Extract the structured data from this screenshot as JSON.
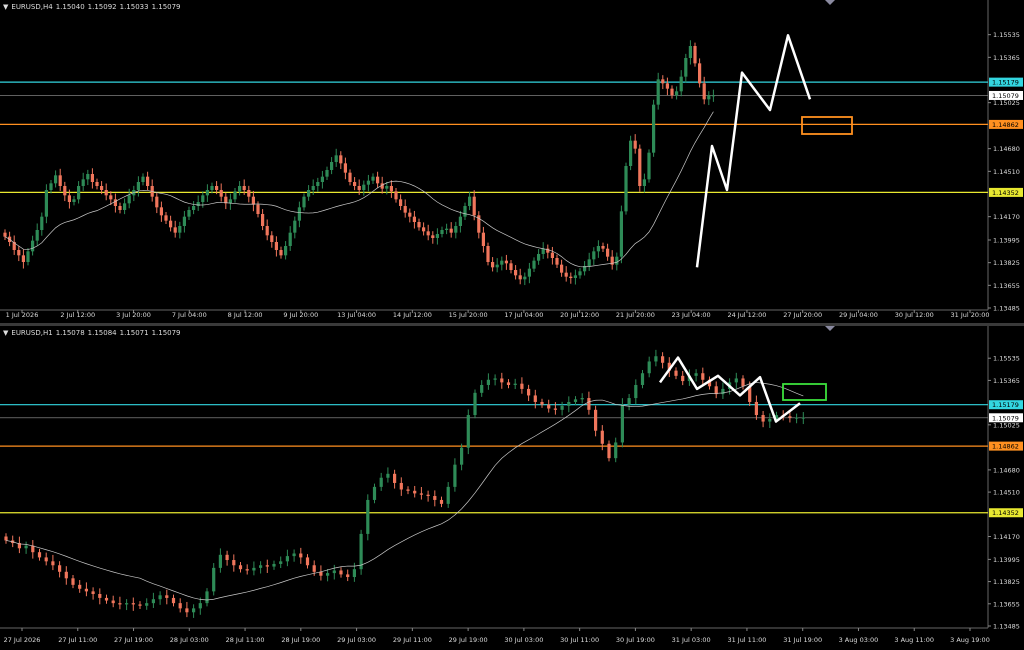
{
  "colors": {
    "bull": "#2e8b57",
    "bear": "#f0765c",
    "wick_bull": "#2e8b57",
    "wick_bear": "#f0765c",
    "ma": "#c8c8c8",
    "cyan": "#33d6e0",
    "orange": "#ff9020",
    "yellow": "#e8e830",
    "price": "#9a9a9a",
    "green_box": "#3ce03c",
    "white_path": "#ffffff"
  },
  "panes": [
    {
      "id": "h4",
      "symbol": "EURUSD,H4",
      "ohlc": [
        "1.15040",
        "1.15092",
        "1.15033",
        "1.15079"
      ],
      "y_range": [
        1.13485,
        1.15705
      ],
      "price_labels": [
        "1.15535",
        "1.15365",
        "1.15025",
        "1.14680",
        "1.14510",
        "1.14170",
        "1.13995",
        "1.13825",
        "1.13655",
        "1.13485"
      ],
      "price_values": [
        1.15535,
        1.15365,
        1.15025,
        1.1468,
        1.1451,
        1.1417,
        1.13995,
        1.13825,
        1.13655,
        1.13485
      ],
      "tags": [
        {
          "label": "1.15179",
          "value": 1.15179,
          "color": "cyan"
        },
        {
          "label": "1.15079",
          "value": 1.15079,
          "color": "price"
        },
        {
          "label": "1.14862",
          "value": 1.14862,
          "color": "orange"
        },
        {
          "label": "1.14352",
          "value": 1.14352,
          "color": "yellow"
        }
      ],
      "time_labels": [
        "1 Jul 2026",
        "2 Jul 12:00",
        "3 Jul 20:00",
        "7 Jul 04:00",
        "8 Jul 12:00",
        "9 Jul 20:00",
        "13 Jul 04:00",
        "14 Jul 12:00",
        "15 Jul 20:00",
        "17 Jul 04:00",
        "20 Jul 12:00",
        "21 Jul 20:00",
        "23 Jul 04:00",
        "24 Jul 12:00",
        "27 Jul 20:00",
        "29 Jul 04:00",
        "30 Jul 12:00",
        "31 Jul 20:00"
      ],
      "candles": [
        1.1402,
        1.1398,
        1.1392,
        1.1388,
        1.1383,
        1.1391,
        1.1399,
        1.1407,
        1.1417,
        1.1437,
        1.1442,
        1.1448,
        1.144,
        1.1433,
        1.1428,
        1.143,
        1.144,
        1.1445,
        1.1449,
        1.1443,
        1.144,
        1.1437,
        1.1433,
        1.143,
        1.1425,
        1.1422,
        1.1427,
        1.1433,
        1.1437,
        1.1443,
        1.1447,
        1.144,
        1.1432,
        1.1424,
        1.1418,
        1.1414,
        1.1409,
        1.1405,
        1.141,
        1.1417,
        1.1422,
        1.1425,
        1.1428,
        1.1433,
        1.1437,
        1.144,
        1.1437,
        1.1432,
        1.1427,
        1.143,
        1.1436,
        1.144,
        1.1437,
        1.1432,
        1.1426,
        1.1419,
        1.141,
        1.1403,
        1.1398,
        1.1392,
        1.1388,
        1.1395,
        1.1405,
        1.1414,
        1.1424,
        1.1432,
        1.1437,
        1.144,
        1.1443,
        1.1447,
        1.1452,
        1.1458,
        1.1463,
        1.1457,
        1.145,
        1.1443,
        1.144,
        1.1437,
        1.1441,
        1.1444,
        1.1447,
        1.1442,
        1.1438,
        1.144,
        1.1436,
        1.143,
        1.1425,
        1.142,
        1.1417,
        1.1413,
        1.1409,
        1.1406,
        1.1403,
        1.1401,
        1.1404,
        1.1407,
        1.1408,
        1.1405,
        1.141,
        1.1417,
        1.1425,
        1.1432,
        1.1418,
        1.1405,
        1.1395,
        1.1383,
        1.1379,
        1.1381,
        1.1384,
        1.1382,
        1.1377,
        1.1373,
        1.137,
        1.1372,
        1.1378,
        1.1384,
        1.1389,
        1.1393,
        1.139,
        1.1386,
        1.1381,
        1.1375,
        1.1372,
        1.1371,
        1.1373,
        1.1376,
        1.138,
        1.1385,
        1.1391,
        1.1395,
        1.1393,
        1.1387,
        1.1381,
        1.1387,
        1.1421,
        1.1455,
        1.1474,
        1.1468,
        1.144,
        1.1445,
        1.1465,
        1.1501,
        1.152,
        1.1517,
        1.1513,
        1.1508,
        1.1511,
        1.1522,
        1.1536,
        1.1545,
        1.1532,
        1.1517,
        1.1505,
        1.1508,
        1.1508
      ],
      "wave_path": [
        [
          1.1379,
          0
        ],
        [
          1.147,
          1
        ],
        [
          1.1437,
          2
        ],
        [
          1.1525,
          3
        ],
        [
          1.1497,
          4
        ],
        [
          1.1553,
          5
        ],
        [
          1.1505,
          6
        ]
      ]
    },
    {
      "id": "h1",
      "symbol": "EURUSD,H1",
      "ohlc": [
        "1.15078",
        "1.15084",
        "1.15071",
        "1.15079"
      ],
      "y_range": [
        1.13485,
        1.15705
      ],
      "price_labels": [
        "1.15535",
        "1.15365",
        "1.15025",
        "1.14680",
        "1.14510",
        "1.14170",
        "1.13995",
        "1.13825",
        "1.13655",
        "1.13485"
      ],
      "price_values": [
        1.15535,
        1.15365,
        1.15025,
        1.1468,
        1.1451,
        1.1417,
        1.13995,
        1.13825,
        1.13655,
        1.13485
      ],
      "tags": [
        {
          "label": "1.15179",
          "value": 1.15179,
          "color": "cyan"
        },
        {
          "label": "1.15079",
          "value": 1.15079,
          "color": "price"
        },
        {
          "label": "1.14862",
          "value": 1.14862,
          "color": "orange"
        },
        {
          "label": "1.14352",
          "value": 1.14352,
          "color": "yellow"
        }
      ],
      "time_labels": [
        "27 Jul 2026",
        "27 Jul 11:00",
        "27 Jul 19:00",
        "28 Jul 03:00",
        "28 Jul 11:00",
        "28 Jul 19:00",
        "29 Jul 03:00",
        "29 Jul 11:00",
        "29 Jul 19:00",
        "30 Jul 03:00",
        "30 Jul 11:00",
        "30 Jul 19:00",
        "31 Jul 03:00",
        "31 Jul 11:00",
        "31 Jul 19:00",
        "3 Aug 03:00",
        "3 Aug 11:00",
        "3 Aug 19:00"
      ],
      "candles": [
        1.1414,
        1.1412,
        1.1408,
        1.141,
        1.1405,
        1.1401,
        1.1398,
        1.1395,
        1.139,
        1.1385,
        1.138,
        1.1377,
        1.1375,
        1.1373,
        1.137,
        1.1368,
        1.1366,
        1.1365,
        1.1366,
        1.1365,
        1.1364,
        1.1366,
        1.1369,
        1.1372,
        1.137,
        1.1366,
        1.1362,
        1.1359,
        1.1362,
        1.1366,
        1.1375,
        1.1393,
        1.1403,
        1.1399,
        1.1395,
        1.1392,
        1.1391,
        1.1393,
        1.1395,
        1.1394,
        1.1396,
        1.1398,
        1.1402,
        1.1404,
        1.1401,
        1.1395,
        1.139,
        1.1387,
        1.1389,
        1.1391,
        1.1388,
        1.1386,
        1.1392,
        1.1419,
        1.1445,
        1.1455,
        1.1462,
        1.1465,
        1.1458,
        1.1453,
        1.1452,
        1.145,
        1.1449,
        1.1448,
        1.1445,
        1.1442,
        1.1455,
        1.1472,
        1.1485,
        1.151,
        1.1527,
        1.1533,
        1.1537,
        1.1538,
        1.1535,
        1.1533,
        1.1534,
        1.153,
        1.1525,
        1.152,
        1.1518,
        1.1515,
        1.1514,
        1.1517,
        1.152,
        1.1522,
        1.1523,
        1.1514,
        1.1498,
        1.1488,
        1.1477,
        1.1489,
        1.1518,
        1.1523,
        1.1533,
        1.1542,
        1.1551,
        1.1555,
        1.155,
        1.1544,
        1.154,
        1.1536,
        1.154,
        1.1542,
        1.1537,
        1.1532,
        1.1526,
        1.153,
        1.1535,
        1.1538,
        1.1532,
        1.152,
        1.151,
        1.1505,
        1.1507,
        1.151,
        1.1509,
        1.1508,
        1.1508,
        1.1508
      ],
      "wave_path": [
        [
          1.1535,
          0
        ],
        [
          1.1554,
          1
        ],
        [
          1.153,
          2
        ],
        [
          1.154,
          3
        ],
        [
          1.1525,
          4
        ],
        [
          1.1539,
          5
        ],
        [
          1.1505,
          6
        ],
        [
          1.1519,
          7
        ]
      ]
    }
  ]
}
